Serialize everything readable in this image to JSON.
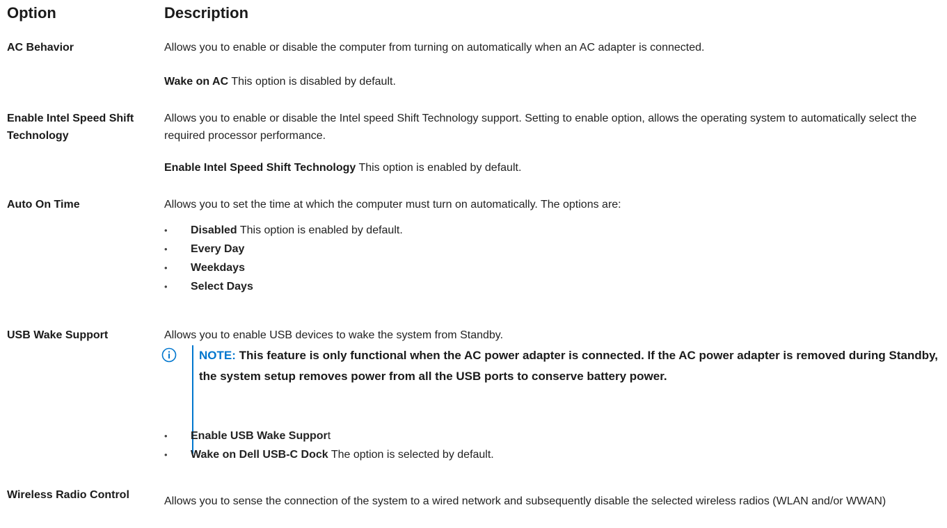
{
  "header": {
    "option": "Option",
    "description": "Description"
  },
  "rows": {
    "ac_behavior": {
      "label": "AC Behavior",
      "desc": "Allows you to enable or disable the computer from turning on automatically when an AC adapter is connected.",
      "sub_bold": "Wake on AC",
      "sub_text": " This option is disabled by default."
    },
    "speed_shift": {
      "label": "Enable Intel Speed Shift Technology",
      "desc": "Allows you to enable or disable the Intel speed Shift Technology support. Setting to enable option, allows the operating system to automatically select the required processor performance.",
      "sub_bold": "Enable Intel Speed Shift Technology",
      "sub_text": " This option is enabled by default."
    },
    "auto_on": {
      "label": "Auto On Time",
      "desc": "Allows you to set the time at which the computer must turn on automatically. The options are:",
      "options": [
        {
          "bold": "Disabled",
          "text": " This option is enabled by default."
        },
        {
          "bold": "Every Day",
          "text": ""
        },
        {
          "bold": "Weekdays",
          "text": ""
        },
        {
          "bold": "Select Days",
          "text": ""
        }
      ]
    },
    "usb_wake": {
      "label": "USB Wake Support",
      "desc": "Allows you to enable USB devices to wake the system from Standby.",
      "note_label": "NOTE:",
      "note_text": " This feature is only functional when the AC power adapter is connected. If the AC power adapter is removed during Standby, the system setup removes power from all the USB ports to conserve battery power.",
      "options": [
        {
          "bold": "Enable USB Wake Suppor",
          "text": "t"
        },
        {
          "bold": "Wake on Dell USB-C Dock",
          "text": " The option is selected by default."
        }
      ]
    },
    "wireless": {
      "label": "Wireless Radio Control",
      "desc": "Allows you to sense the connection of the system to a wired network and subsequently disable the selected wireless radios (WLAN and/or WWAN)"
    }
  },
  "bullet_char": "•",
  "colors": {
    "accent": "#0076ce",
    "text": "#222222"
  },
  "icons": {
    "note": "info-icon"
  }
}
